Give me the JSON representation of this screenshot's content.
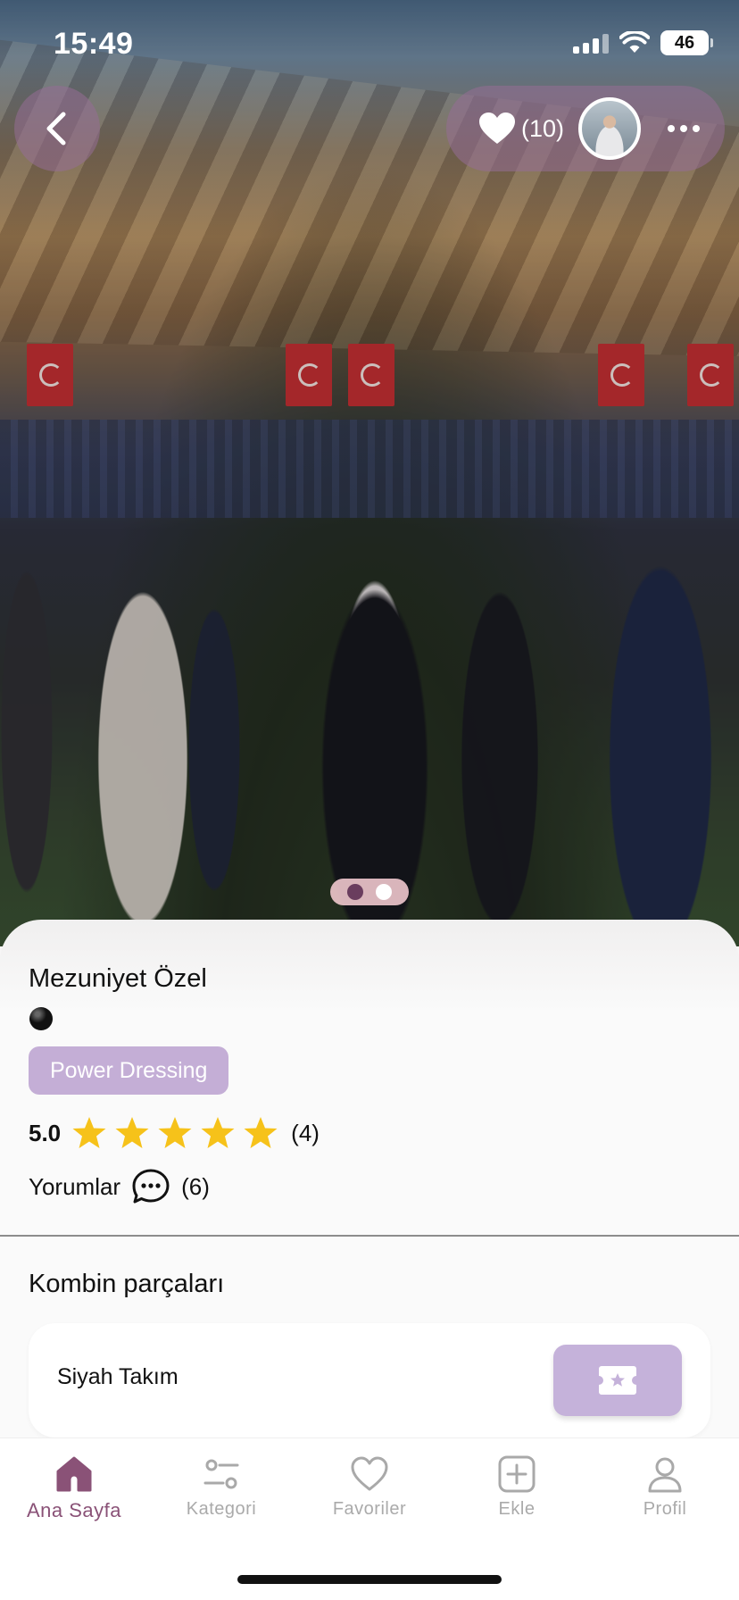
{
  "status_bar": {
    "time": "15:49",
    "battery": "46"
  },
  "header": {
    "like_count": "(10)"
  },
  "post": {
    "title": "Mezuniyet Özel",
    "tag": "Power Dressing",
    "rating": "5.0",
    "rating_count": "(4)",
    "stars_filled": 5,
    "comments_label": "Yorumlar",
    "comments_count": "(6)"
  },
  "pieces": {
    "title": "Kombin parçaları",
    "items": [
      {
        "name": "Siyah Takım"
      }
    ]
  },
  "tabs": [
    {
      "label": "Ana Sayfa",
      "icon": "home-icon",
      "active": true
    },
    {
      "label": "Kategori",
      "icon": "sliders-icon",
      "active": false
    },
    {
      "label": "Favoriler",
      "icon": "heart-icon",
      "active": false
    },
    {
      "label": "Ekle",
      "icon": "plus-square-icon",
      "active": false
    },
    {
      "label": "Profil",
      "icon": "user-icon",
      "active": false
    }
  ],
  "colors": {
    "accent": "#8a5277",
    "tag_bg": "#c4aed6",
    "star": "#f6c21a"
  }
}
